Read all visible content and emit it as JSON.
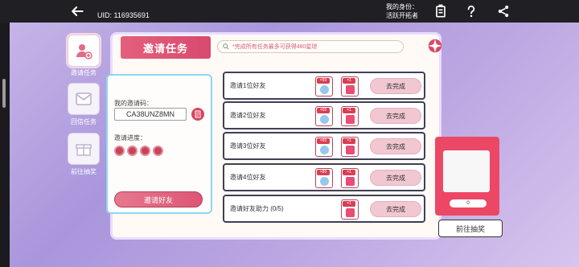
{
  "topbar": {
    "username": "",
    "uid": "UID: 116935691",
    "role_label": "我的身份：",
    "role_value": "活跃开拓者"
  },
  "sidebar": {
    "items": [
      {
        "label": "邀请任务"
      },
      {
        "label": "回信任务"
      },
      {
        "label": "前往抽奖"
      }
    ]
  },
  "main": {
    "title": "邀请任务",
    "notice": "*完成所有任务最多可获得480星琼"
  },
  "invite": {
    "code_label": "我的邀请码：",
    "code": "CA38UNZ8MN",
    "progress_label": "邀请进度：",
    "button": "邀请好友"
  },
  "tasks": [
    {
      "name": "邀请1位好友",
      "reward1": "×50",
      "reward2": "×1",
      "button": "去完成"
    },
    {
      "name": "邀请2位好友",
      "reward1": "×60",
      "reward2": "×1",
      "button": "去完成"
    },
    {
      "name": "邀请3位好友",
      "reward1": "×60",
      "reward2": "×1",
      "button": "去完成"
    },
    {
      "name": "邀请4位好友",
      "reward1": "×80",
      "reward2": "×1",
      "button": "去完成"
    },
    {
      "name": "邀请好友助力 (0/5)",
      "reward2": "×1",
      "button": "去完成"
    }
  ],
  "prize": {
    "count": "0",
    "button": "前往抽奖"
  }
}
